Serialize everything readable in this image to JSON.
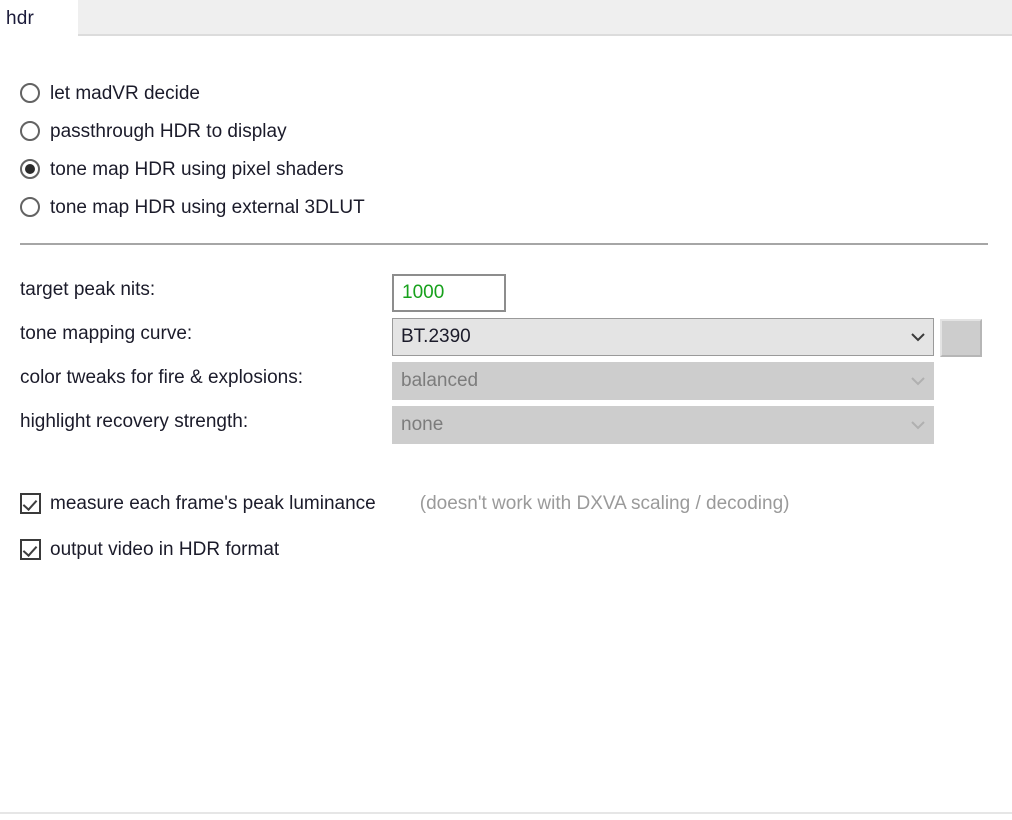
{
  "window": {
    "title": "hdr"
  },
  "tabs": [
    {
      "label": "hdr",
      "active": true
    }
  ],
  "hdr_mode": {
    "options": [
      {
        "label": "let madVR decide",
        "selected": false
      },
      {
        "label": "passthrough HDR to display",
        "selected": false
      },
      {
        "label": "tone map HDR using pixel shaders",
        "selected": true
      },
      {
        "label": "tone map HDR using external 3DLUT",
        "selected": false
      }
    ]
  },
  "fields": {
    "target_peak_nits": {
      "label": "target peak nits:",
      "value": "1000",
      "value_color": "#17a11c",
      "enabled": true
    },
    "tone_mapping_curve": {
      "label": "tone mapping curve:",
      "value": "BT.2390",
      "enabled": true,
      "has_aux_button": true
    },
    "color_tweaks": {
      "label": "color tweaks for fire & explosions:",
      "value": "balanced",
      "enabled": false
    },
    "highlight_recovery": {
      "label": "highlight recovery strength:",
      "value": "none",
      "enabled": false
    }
  },
  "checkboxes": [
    {
      "label": "measure each frame's peak luminance",
      "checked": true,
      "hint": "(doesn't work with DXVA scaling / decoding)"
    },
    {
      "label": "output video in HDR format",
      "checked": true,
      "hint": ""
    }
  ],
  "icons": {
    "chevron_down": "chevron-down-icon"
  },
  "colors": {
    "accent_value_green": "#17a11c",
    "divider": "#a6a6a6",
    "disabled_text": "#7c7c7c",
    "hint_text": "#9a9a9a",
    "select_enabled_bg": "#e4e4e4",
    "select_disabled_bg": "#cdcdcd",
    "tab_inactive_bg": "#efefef"
  }
}
